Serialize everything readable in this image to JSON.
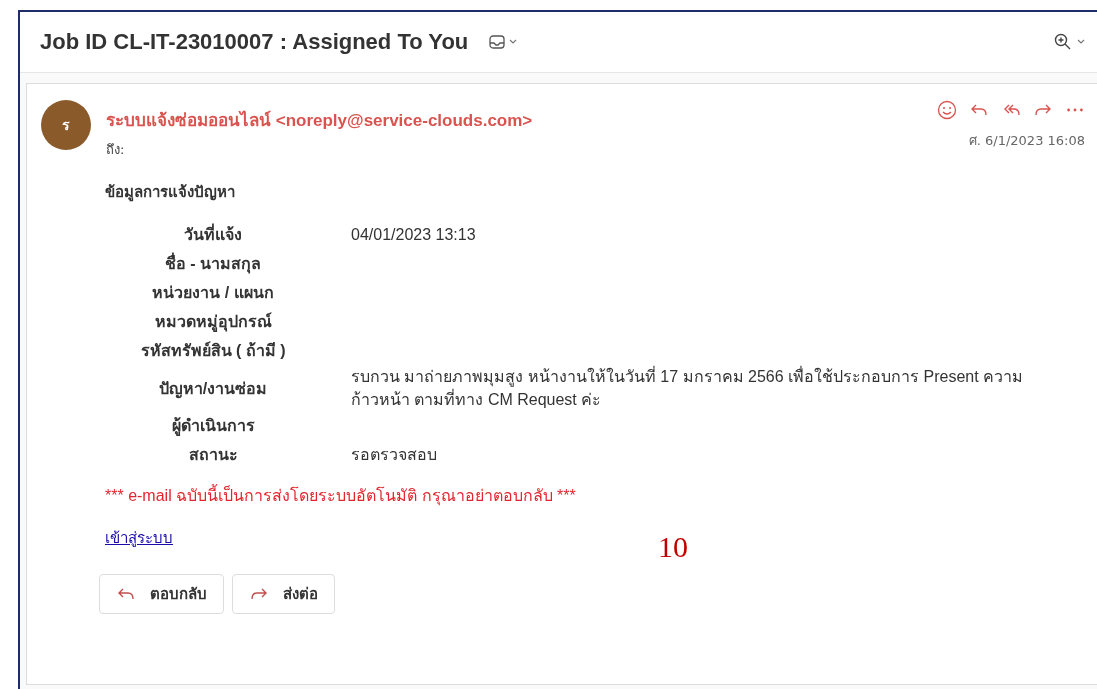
{
  "header": {
    "subject": "Job ID CL-IT-23010007 : Assigned To You"
  },
  "message": {
    "avatar_letter": "ร",
    "sender": "ระบบแจ้งซ่อมออนไลน์ <noreply@service-clouds.com>",
    "to_label": "ถึง:",
    "date": "ศ. 6/1/2023 16:08",
    "heading": "ข้อมูลการแจ้งปัญหา",
    "fields": [
      {
        "label": "วันที่แจ้ง",
        "value": "04/01/2023 13:13"
      },
      {
        "label": "ชื่อ - นามสกุล"
      },
      {
        "label": "หน่วยงาน / แผนก"
      },
      {
        "label": "หมวดหมู่อุปกรณ์"
      },
      {
        "label": "รหัสทรัพย์สิน ( ถ้ามี )"
      },
      {
        "label": "ปัญหา/งานซ่อม",
        "value": "รบกวน มาถ่ายภาพมุมสูง หน้างานให้ในวันที่ 17 มกราคม 2566 เพื่อใช้ประกอบการ Present ความก้าวหน้า ตามที่ทาง CM Request ค่ะ"
      },
      {
        "label": "ผู้ดำเนินการ"
      },
      {
        "label": "สถานะ",
        "value": "รอตรวจสอบ"
      }
    ],
    "notice": "*** e-mail ฉบับนี้เป็นการส่งโดยระบบอัตโนมัติ กรุณาอย่าตอบกลับ ***",
    "link": "เข้าสู่ระบบ",
    "annotation": "10",
    "buttons": [
      {
        "kind": "reply",
        "label": "ตอบกลับ"
      },
      {
        "kind": "forward",
        "label": "ส่งต่อ"
      }
    ]
  }
}
